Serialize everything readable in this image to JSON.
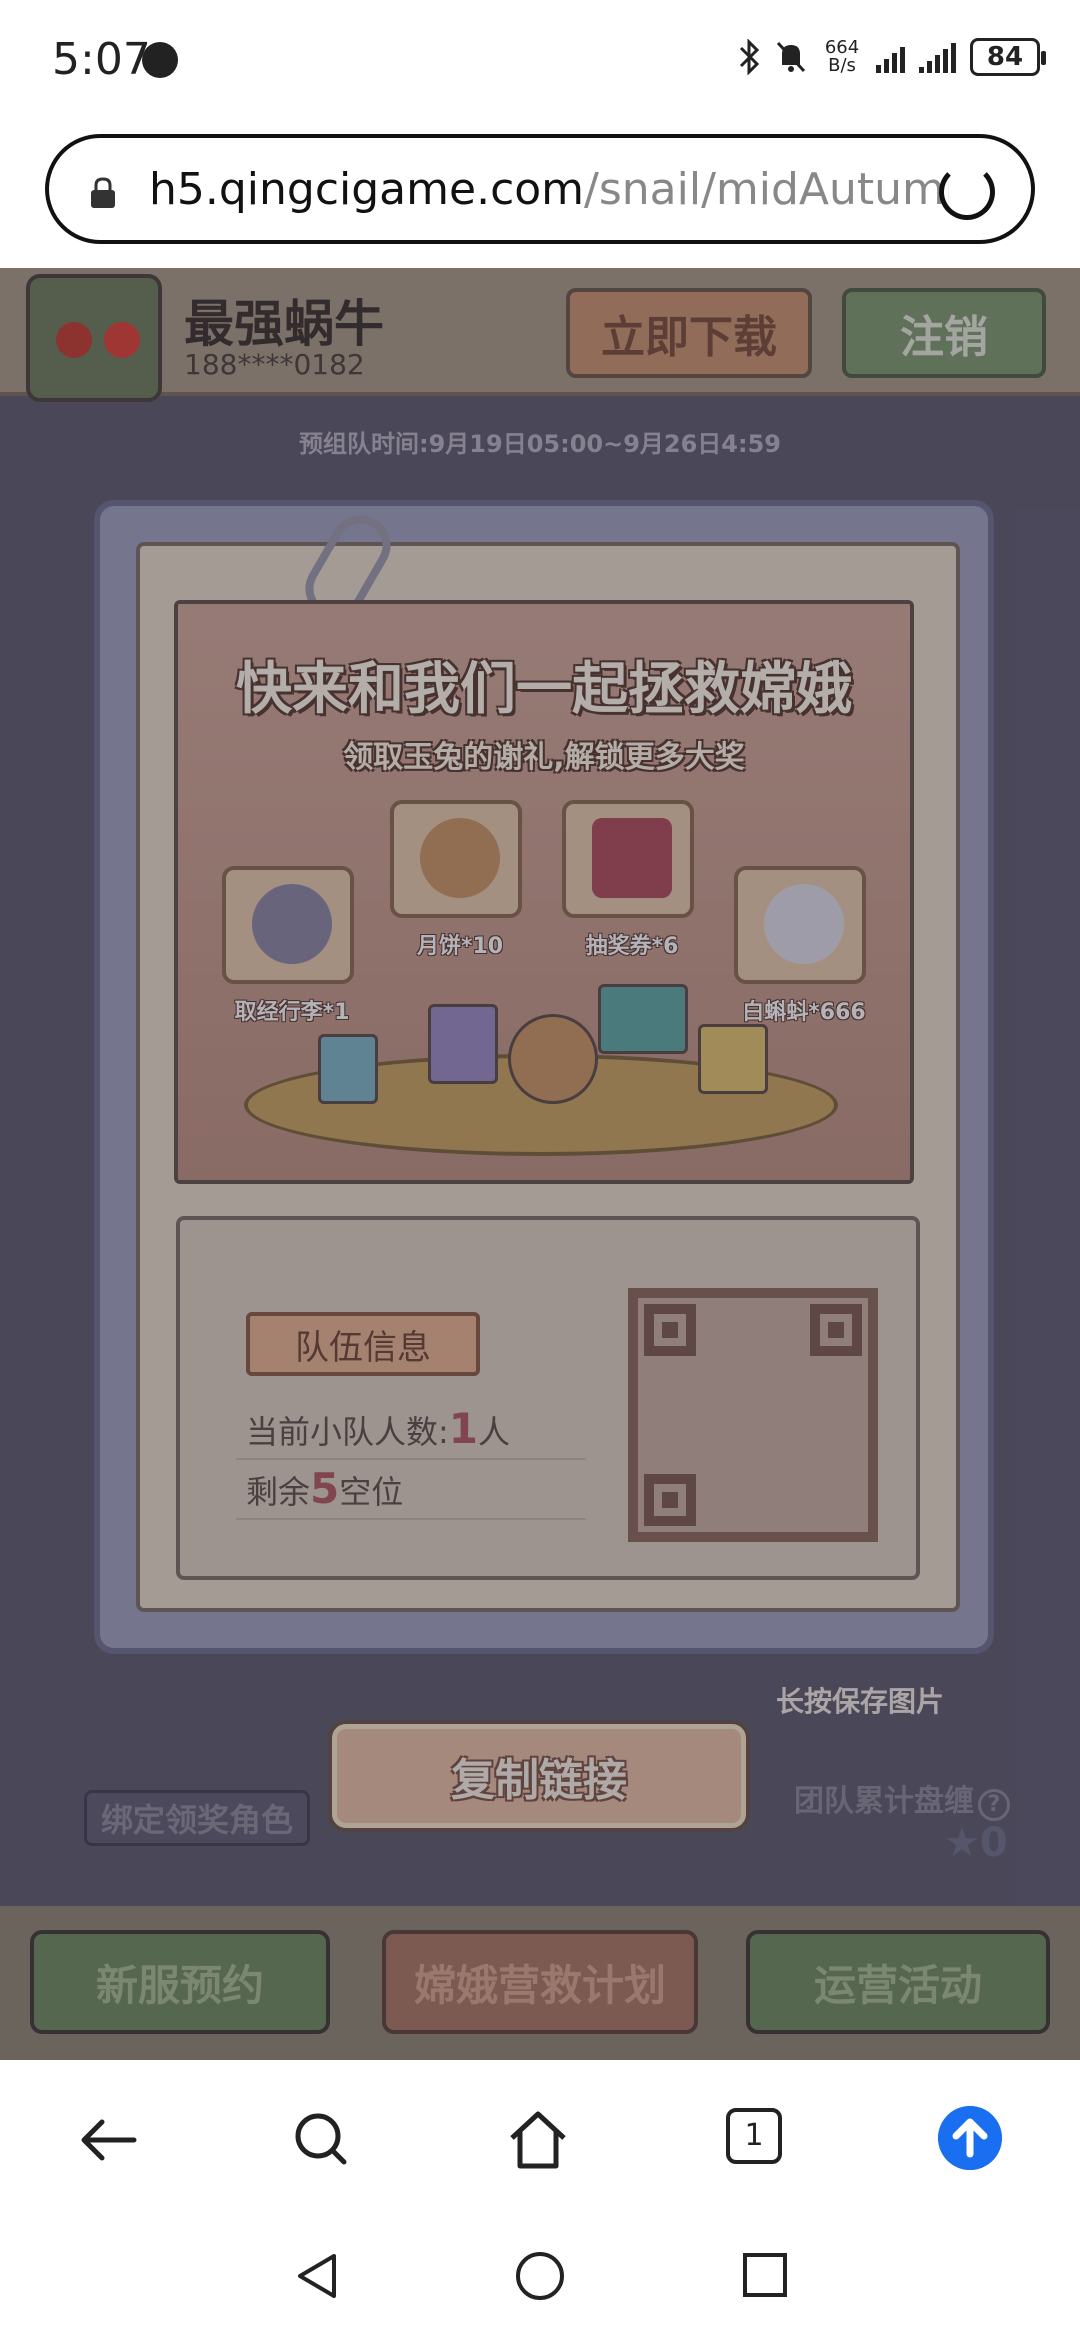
{
  "status_bar": {
    "time": "5:07",
    "net_speed_value": "664",
    "net_speed_unit": "B/s",
    "battery": "84"
  },
  "browser": {
    "url_host": "h5.qingcigame.com",
    "url_path": "/snail/midAutumn/",
    "tab_count": "1"
  },
  "game": {
    "title": "最强蜗牛",
    "phone": "188****0182",
    "download_label": "立即下载",
    "logout_label": "注销",
    "pre_team_time": "预组队时间:9月19日05:00~9月26日4:59"
  },
  "modal": {
    "banner_title": "快来和我们一起拯救嫦娥",
    "banner_subtitle": "领取玉兔的谢礼,解锁更多大奖",
    "rewards": [
      {
        "label": "取经行李*1"
      },
      {
        "label": "月饼*10"
      },
      {
        "label": "抽奖券*6"
      },
      {
        "label": "白蝌蚪*666"
      }
    ],
    "team_title": "队伍信息",
    "team_count_label": "当前小队人数:",
    "team_count_value": "1",
    "team_count_unit": "人",
    "slots_prefix": "剩余",
    "slots_value": "5",
    "slots_suffix": "空位"
  },
  "controls": {
    "save_hint": "长按保存图片",
    "copy_link": "复制链接",
    "bind_role": "绑定领奖角色",
    "team_total_label": "团队累计盘缠",
    "team_total_value": "0"
  },
  "bottom_nav": {
    "item1": "新服预约",
    "item2": "嫦娥营救计划",
    "item3": "运营活动"
  }
}
